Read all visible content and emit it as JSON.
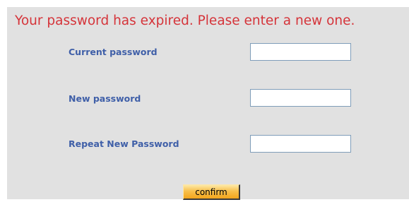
{
  "title": "Your password has expired. Please enter a new one.",
  "form": {
    "current_password_label": "Current password",
    "current_password_value": "",
    "new_password_label": "New password",
    "new_password_value": "",
    "repeat_password_label": "Repeat New Password",
    "repeat_password_value": "",
    "confirm_label": "confirm"
  },
  "colors": {
    "title": "#d5343a",
    "label": "#3f5fa8",
    "panel_background": "#e1e1e1",
    "button": "#f8b43a"
  }
}
